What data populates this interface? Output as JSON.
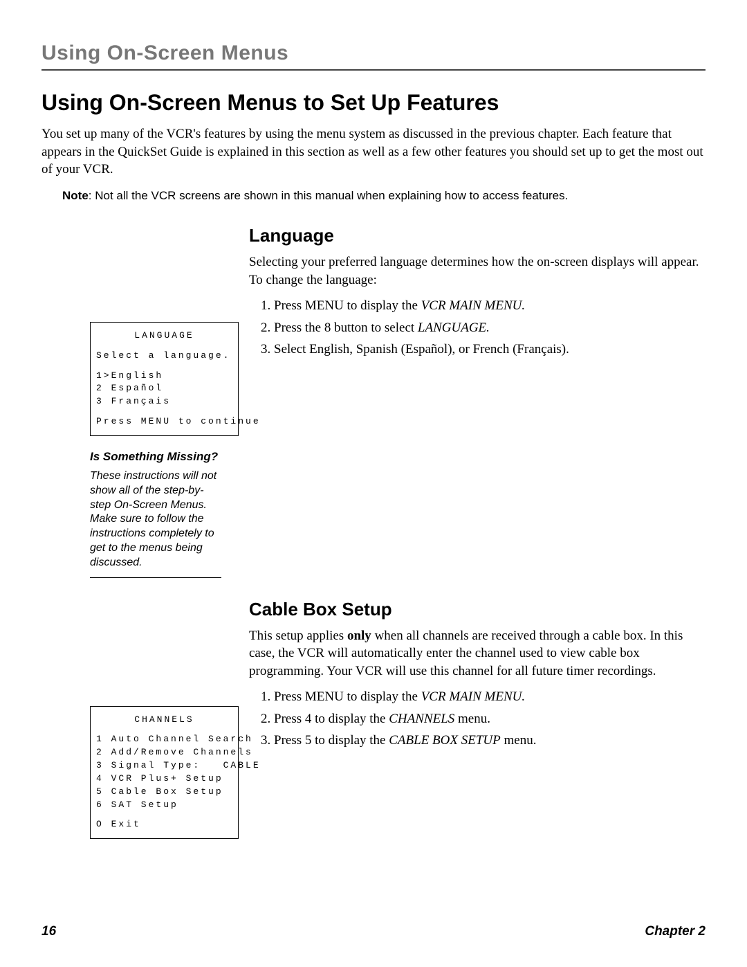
{
  "running_header": "Using On-Screen Menus",
  "page_title": "Using On-Screen Menus to Set Up Features",
  "intro": "You set up many of the VCR's features by using the menu system as discussed in the previous chapter. Each feature that appears in the QuickSet Guide is explained in this section as well as a few other features you should set up to get the most out of your VCR.",
  "note_label": "Note",
  "note_text": ": Not all the VCR screens are shown in this manual when explaining how to access features.",
  "language": {
    "heading": "Language",
    "para": "Selecting your preferred language determines how the on-screen displays will appear. To change the language:",
    "step1_a": "Press MENU to display the ",
    "step1_b": "VCR MAIN MENU.",
    "step2_a": "Press the 8 button to select ",
    "step2_b": "LANGUAGE.",
    "step3": "Select English, Spanish (Español), or French (Français).",
    "osd": {
      "title": "LANGUAGE",
      "prompt": "Select a language.",
      "opt1": "1>English",
      "opt2": "2 Español",
      "opt3": "3 Français",
      "footer": "Press MENU to continue"
    }
  },
  "sidebar": {
    "heading": "Is Something Missing?",
    "text": "These instructions will not show all of the step-by-step On-Screen Menus. Make sure to follow the instructions completely to get to the menus being discussed."
  },
  "cable": {
    "heading": "Cable Box Setup",
    "para_a": "This setup applies ",
    "para_b": "only",
    "para_c": " when all channels are received through a cable box. In this case, the VCR will automatically enter the channel used to view cable box programming. Your VCR will use this channel for all future timer recordings.",
    "step1_a": "Press MENU to display the ",
    "step1_b": "VCR MAIN MENU.",
    "step2_a": "Press 4 to display the ",
    "step2_b": "CHANNELS",
    "step2_c": " menu.",
    "step3_a": "Press 5 to display the ",
    "step3_b": "CABLE BOX SETUP",
    "step3_c": " menu.",
    "osd": {
      "title": "CHANNELS",
      "l1": "1 Auto Channel Search",
      "l2": "2 Add/Remove Channels",
      "l3": "3 Signal Type:   CABLE",
      "l4": "4 VCR Plus+ Setup",
      "l5": "5 Cable Box Setup",
      "l6": "6 SAT Setup",
      "l7": "O Exit"
    }
  },
  "footer": {
    "page": "16",
    "chapter": "Chapter 2"
  }
}
